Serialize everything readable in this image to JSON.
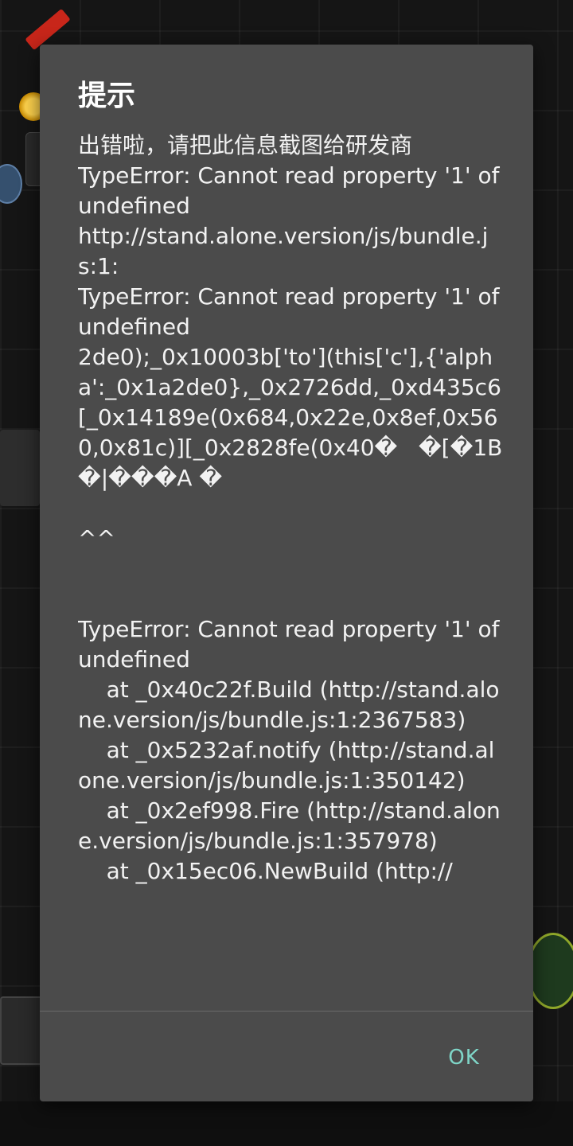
{
  "dialog": {
    "title": "提示",
    "message": "出错啦，请把此信息截图给研发商\nTypeError: Cannot read property '1' of undefined\nhttp://stand.alone.version/js/bundle.js:1:\nTypeError: Cannot read property '1' of undefined\n2de0);_0x10003b['to'](this['c'],{'alpha':_0x1a2de0},_0x2726dd,_0xd435c6[_0x14189e(0x684,0x22e,0x8ef,0x560,0x81c)][_0x2828fe(0x40�   �[�1B�|���A �\n\n^^\n\n\nTypeError: Cannot read property '1' of undefined\n    at _0x40c22f.Build (http://stand.alone.version/js/bundle.js:1:2367583)\n    at _0x5232af.notify (http://stand.alone.version/js/bundle.js:1:350142)\n    at _0x2ef998.Fire (http://stand.alone.version/js/bundle.js:1:357978)\n    at _0x15ec06.NewBuild (http://",
    "ok_label": "OK"
  },
  "colors": {
    "dialog_bg": "#4b4b4b",
    "text": "#f2f2f2",
    "accent": "#7fd6c8",
    "scrim": "#151515"
  }
}
